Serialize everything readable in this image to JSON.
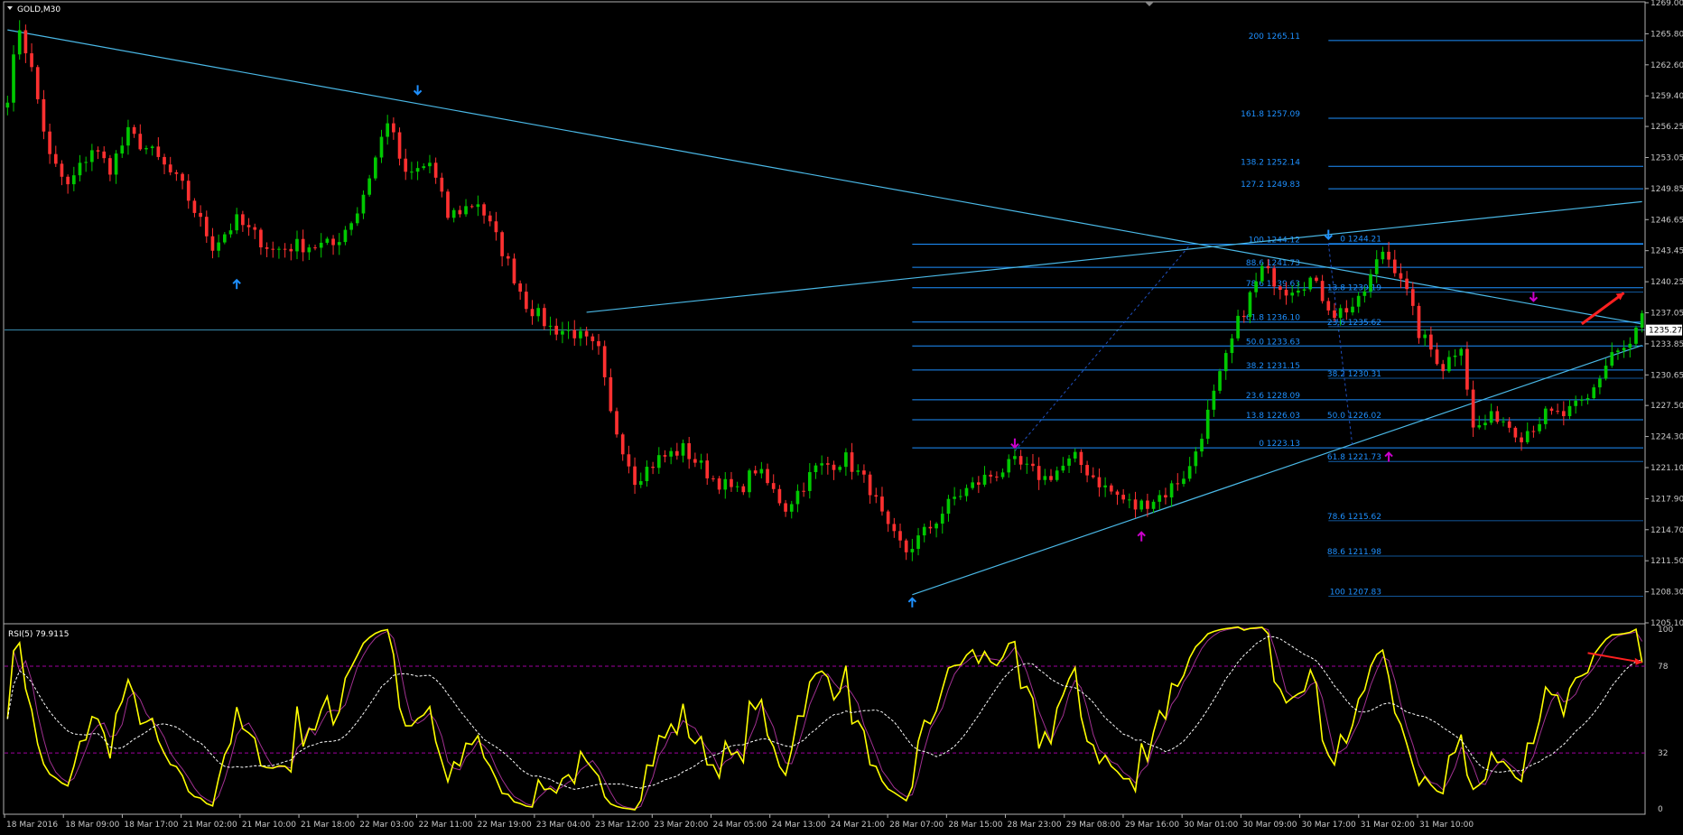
{
  "chart_data": {
    "type": "line",
    "title": "GOLD,M30",
    "symbol": "GOLD",
    "timeframe": "M30",
    "price_axis": {
      "ticks": [
        "1269.00",
        "1265.80",
        "1262.60",
        "1259.40",
        "1256.25",
        "1253.05",
        "1249.85",
        "1246.65",
        "1243.45",
        "1240.25",
        "1237.05",
        "1233.85",
        "1230.65",
        "1227.50",
        "1224.30",
        "1221.10",
        "1217.90",
        "1214.70",
        "1211.50",
        "1208.30",
        "1205.10"
      ],
      "ylim": [
        1205.1,
        1269.0
      ],
      "current_price": "1235.27"
    },
    "time_axis": {
      "ticks": [
        "18 Mar 2016",
        "18 Mar 09:00",
        "18 Mar 17:00",
        "21 Mar 02:00",
        "21 Mar 10:00",
        "21 Mar 18:00",
        "22 Mar 03:00",
        "22 Mar 11:00",
        "22 Mar 19:00",
        "23 Mar 04:00",
        "23 Mar 12:00",
        "23 Mar 20:00",
        "24 Mar 05:00",
        "24 Mar 13:00",
        "24 Mar 21:00",
        "28 Mar 07:00",
        "28 Mar 15:00",
        "28 Mar 23:00",
        "29 Mar 08:00",
        "29 Mar 16:00",
        "30 Mar 01:00",
        "30 Mar 09:00",
        "30 Mar 17:00",
        "31 Mar 02:00",
        "31 Mar 10:00"
      ]
    },
    "price_path": [
      [
        0,
        1259.5
      ],
      [
        2,
        1266.5
      ],
      [
        4,
        1262.0
      ],
      [
        7,
        1253.0
      ],
      [
        10,
        1250.0
      ],
      [
        14,
        1254.0
      ],
      [
        17,
        1252.0
      ],
      [
        20,
        1255.5
      ],
      [
        24,
        1253.5
      ],
      [
        29,
        1250.0
      ],
      [
        34,
        1244.0
      ],
      [
        38,
        1246.5
      ],
      [
        44,
        1243.5
      ],
      [
        48,
        1244.0
      ],
      [
        54,
        1244.0
      ],
      [
        58,
        1247.5
      ],
      [
        61,
        1253.0
      ],
      [
        63,
        1257.0
      ],
      [
        66,
        1251.0
      ],
      [
        70,
        1252.5
      ],
      [
        73,
        1247.0
      ],
      [
        78,
        1248.5
      ],
      [
        82,
        1243.5
      ],
      [
        86,
        1238.0
      ],
      [
        90,
        1235.5
      ],
      [
        94,
        1235.0
      ],
      [
        98,
        1233.0
      ],
      [
        100,
        1226.5
      ],
      [
        104,
        1220.0
      ],
      [
        108,
        1222.0
      ],
      [
        112,
        1223.0
      ],
      [
        117,
        1220.0
      ],
      [
        121,
        1218.5
      ],
      [
        124,
        1221.0
      ],
      [
        129,
        1217.0
      ],
      [
        134,
        1221.0
      ],
      [
        139,
        1222.0
      ],
      [
        143,
        1219.0
      ],
      [
        146,
        1214.5
      ],
      [
        149,
        1212.5
      ],
      [
        153,
        1215.0
      ],
      [
        157,
        1218.0
      ],
      [
        162,
        1220.0
      ],
      [
        167,
        1221.5
      ],
      [
        172,
        1220.0
      ],
      [
        177,
        1222.0
      ],
      [
        182,
        1219.0
      ],
      [
        187,
        1217.0
      ],
      [
        192,
        1218.5
      ],
      [
        196,
        1221.0
      ],
      [
        200,
        1228.5
      ],
      [
        204,
        1236.0
      ],
      [
        208,
        1241.5
      ],
      [
        212,
        1239.5
      ],
      [
        216,
        1240.5
      ],
      [
        220,
        1237.0
      ],
      [
        224,
        1238.0
      ],
      [
        228,
        1243.5
      ],
      [
        231,
        1241.0
      ],
      [
        234,
        1235.0
      ],
      [
        238,
        1231.5
      ],
      [
        241,
        1234.0
      ],
      [
        243,
        1225.0
      ],
      [
        247,
        1226.5
      ],
      [
        251,
        1224.5
      ],
      [
        255,
        1226.5
      ],
      [
        258,
        1226.5
      ],
      [
        262,
        1228.0
      ],
      [
        266,
        1233.0
      ],
      [
        269,
        1233.5
      ],
      [
        271,
        1237.0
      ]
    ],
    "swing_markers": [
      {
        "x": 68,
        "price": 1259.2,
        "dir": "down",
        "color": "#1e90ff"
      },
      {
        "x": 38,
        "price": 1240.8,
        "dir": "up",
        "color": "#1e90ff"
      },
      {
        "x": 150,
        "price": 1208.0,
        "dir": "up",
        "color": "#1e90ff"
      },
      {
        "x": 167,
        "price": 1222.8,
        "dir": "down",
        "color": "#cc00cc"
      },
      {
        "x": 188,
        "price": 1214.8,
        "dir": "up",
        "color": "#cc00cc"
      },
      {
        "x": 219,
        "price": 1244.3,
        "dir": "down",
        "color": "#1e90ff"
      },
      {
        "x": 229,
        "price": 1223.0,
        "dir": "up",
        "color": "#cc00cc"
      },
      {
        "x": 253,
        "price": 1237.9,
        "dir": "down",
        "color": "#cc00cc"
      }
    ],
    "fibo_left": {
      "x_start": 150,
      "label_x": 1440,
      "levels": [
        {
          "label": "100 1244.12",
          "price": 1244.12
        },
        {
          "label": "88.6 1241.73",
          "price": 1241.73
        },
        {
          "label": "78.6 1239.63",
          "price": 1239.63
        },
        {
          "label": "61.8 1236.10",
          "price": 1236.1
        },
        {
          "label": "50.0 1233.63",
          "price": 1233.63
        },
        {
          "label": "38.2 1231.15",
          "price": 1231.15
        },
        {
          "label": "23.6 1228.09",
          "price": 1228.09
        },
        {
          "label": "13.8 1226.03",
          "price": 1226.03
        },
        {
          "label": "0 1223.13",
          "price": 1223.13
        }
      ],
      "extensions": [
        {
          "label": "200 1265.11",
          "price": 1265.11
        },
        {
          "label": "161.8 1257.09",
          "price": 1257.09
        },
        {
          "label": "138.2 1252.14",
          "price": 1252.14
        },
        {
          "label": "127.2 1249.83",
          "price": 1249.83
        }
      ]
    },
    "fibo_right": {
      "label_x": 1530,
      "levels": [
        {
          "label": "0 1244.21",
          "price": 1244.21
        },
        {
          "label": "13.8 1239.19",
          "price": 1239.19
        },
        {
          "label": "23.6 1235.62",
          "price": 1235.62
        },
        {
          "label": "38.2 1230.31",
          "price": 1230.31
        },
        {
          "label": "50.0 1226.02",
          "price": 1226.02
        },
        {
          "label": "61.8 1221.73",
          "price": 1221.73
        },
        {
          "label": "78.6 1215.62",
          "price": 1215.62
        },
        {
          "label": "88.6 1211.98",
          "price": 1211.98
        },
        {
          "label": "100 1207.83",
          "price": 1207.83
        }
      ]
    },
    "trendlines": [
      {
        "x1": 0,
        "p1": 1266.2,
        "x2": 271,
        "p2": 1235.9
      },
      {
        "x1": 150,
        "p1": 1208.0,
        "x2": 271,
        "p2": 1233.7
      },
      {
        "x1": 96,
        "p1": 1237.1,
        "x2": 271,
        "p2": 1248.5
      }
    ],
    "dashed_lines": [
      {
        "x1": 167,
        "p1": 1222.8,
        "x2": 196,
        "p2": 1244.0
      },
      {
        "x1": 219,
        "p1": 1244.2,
        "x2": 223,
        "p2": 1223.2
      }
    ],
    "rsi": {
      "label": "RSI(5) 79.9115",
      "period": 5,
      "value": "79.9115",
      "levels": [
        78,
        32
      ],
      "axis_ticks": [
        "100",
        "78",
        "32",
        "0"
      ],
      "ylim": [
        0,
        100
      ]
    },
    "annotations": {
      "price_arrow_color": "#ff2020",
      "rsi_arrow_color": "#ff2020"
    }
  },
  "colors": {
    "bull": "#00c800",
    "bear": "#ff3030",
    "fibo": "#1e90ff",
    "trend": "#4ab8e6",
    "rsi_line": "#ffff00",
    "rsi_level": "#a000a0",
    "text": "#c8c8c8"
  }
}
